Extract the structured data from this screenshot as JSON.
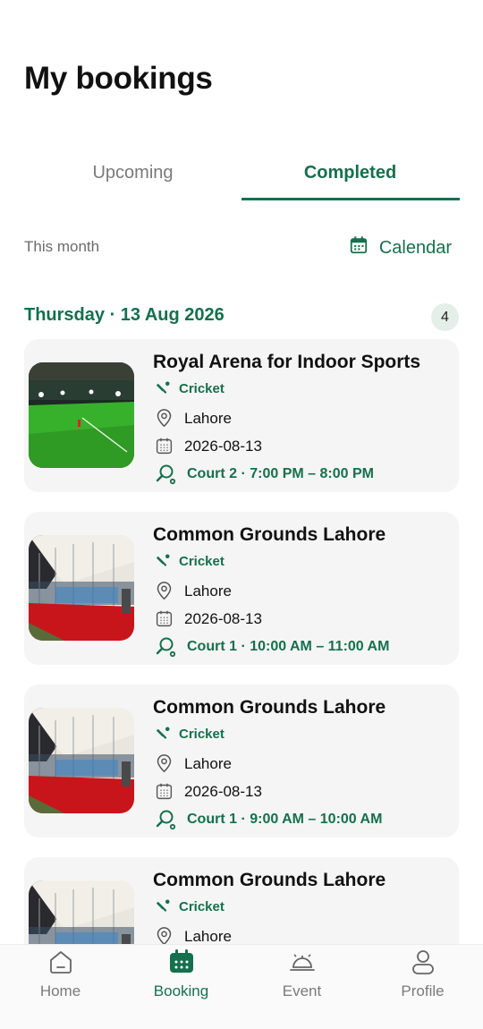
{
  "page": {
    "title": "My bookings"
  },
  "tabs": {
    "upcoming": "Upcoming",
    "completed": "Completed",
    "active": "completed"
  },
  "filter": {
    "label": "This month",
    "calendar_label": "Calendar"
  },
  "group": {
    "date": "Thursday · 13 Aug 2026",
    "count": "4"
  },
  "colors": {
    "accent": "#15704d",
    "card_bg": "#f5f5f5",
    "badge_bg": "#e4efe9",
    "muted": "#7a7a7a"
  },
  "bookings": [
    {
      "venue": "Royal Arena for Indoor Sports",
      "sport": "Cricket",
      "location": "Lahore",
      "date": "2026-08-13",
      "slot": "Court 2 · 7:00 PM – 8:00 PM",
      "image": "outdoor-turf-night"
    },
    {
      "venue": "Common Grounds Lahore",
      "sport": "Cricket",
      "location": "Lahore",
      "date": "2026-08-13",
      "slot": "Court 1 · 10:00 AM – 11:00 AM",
      "image": "covered-padel-court"
    },
    {
      "venue": "Common Grounds Lahore",
      "sport": "Cricket",
      "location": "Lahore",
      "date": "2026-08-13",
      "slot": "Court 1 · 9:00 AM – 10:00 AM",
      "image": "covered-padel-court"
    },
    {
      "venue": "Common Grounds Lahore",
      "sport": "Cricket",
      "location": "Lahore",
      "date": "",
      "slot": "",
      "image": "covered-padel-court"
    }
  ],
  "nav": [
    {
      "label": "Home",
      "icon": "home-icon"
    },
    {
      "label": "Booking",
      "icon": "calendar-icon",
      "active": true
    },
    {
      "label": "Event",
      "icon": "cloche-icon"
    },
    {
      "label": "Profile",
      "icon": "user-icon"
    }
  ]
}
